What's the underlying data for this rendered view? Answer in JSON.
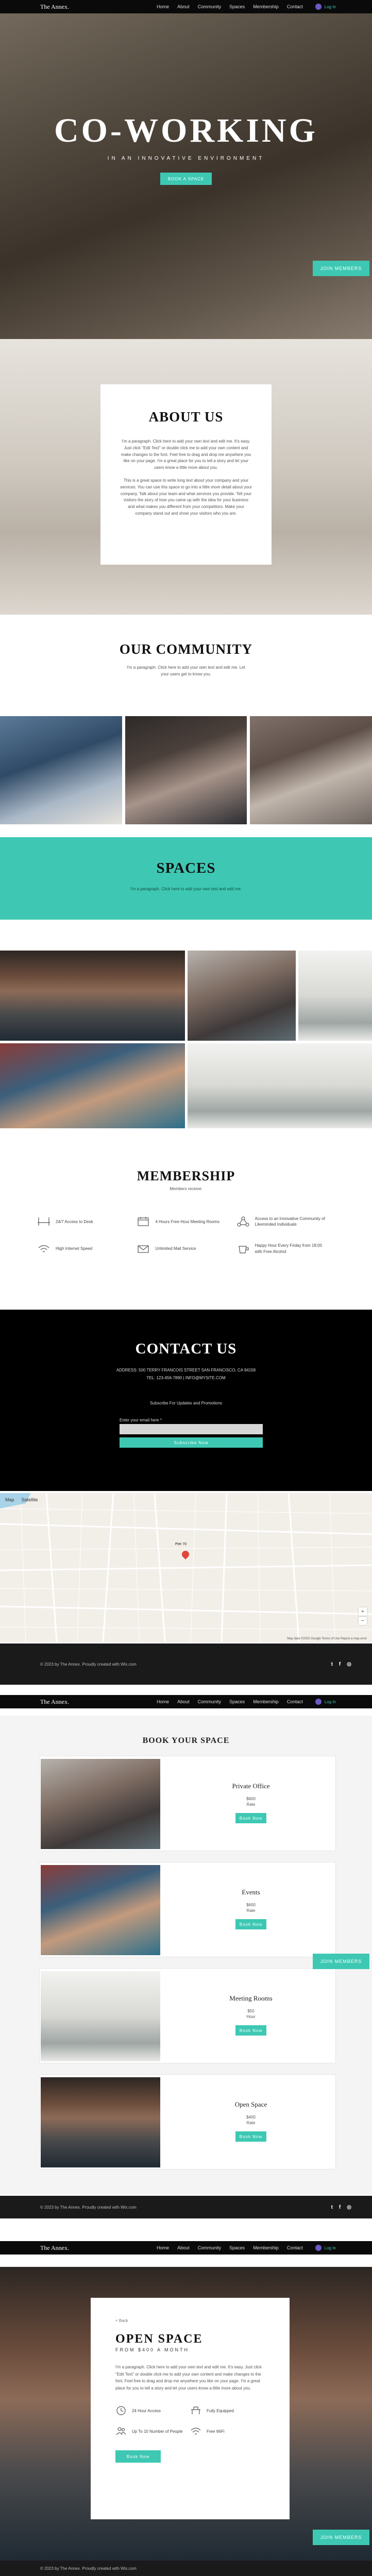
{
  "header": {
    "logo": "The Annex.",
    "nav": [
      "Home",
      "About",
      "Community",
      "Spaces",
      "Membership",
      "Contact"
    ],
    "login": "Log In"
  },
  "hero": {
    "title": "CO-WORKING",
    "subtitle": "IN AN INNOVATIVE ENVIRONMENT",
    "button": "BOOK A SPACE",
    "join_button": "JOIN MEMBERS"
  },
  "about": {
    "title": "ABOUT US",
    "paragraph_1": "I'm a paragraph. Click here to add your own text and edit me. It's easy. Just click \"Edit Text\" or double click me to add your own content and make changes to the font. Feel free to drag and drop me anywhere you like on your page. I'm a great place for you to tell a story and let your users know a little more about you.",
    "paragraph_2": "This is a great space to write long text about your company and your services. You can use this space to go into a little more detail about your company. Talk about your team and what services you provide. Tell your visitors the story of how you came up with the idea for your business and what makes you different from your competitors. Make your company stand out and show your visitors who you are."
  },
  "community": {
    "title": "OUR COMMUNITY",
    "text": "I'm a paragraph. Click here to add your own text and edit me. Let your users get to know you."
  },
  "spaces": {
    "title": "SPACES",
    "text": "I'm a paragraph. Click here to add your own text and edit me."
  },
  "membership": {
    "title": "MEMBERSHIP",
    "subtitle": "Members receive:",
    "perks": [
      {
        "icon": "chair-icon",
        "text": "24/7 Access to Desk"
      },
      {
        "icon": "calendar-icon",
        "text": "4 Hours Free Hour Meeting Rooms"
      },
      {
        "icon": "network-icon",
        "text": "Access to an Innovative Community of Likeminded Individuals"
      },
      {
        "icon": "wifi-icon",
        "text": "High Internet Speed"
      },
      {
        "icon": "mail-icon",
        "text": "Unlimited Mail Service"
      },
      {
        "icon": "coffee-icon",
        "text": "Happy Hour Every Friday from 18:00 with Free Alcohol"
      }
    ]
  },
  "contact": {
    "title": "CONTACT US",
    "address": "ADDRESS: 500 TERRY FRANCOIS STREET SAN FRANCISCO, CA 94158",
    "phone_email": "TEL: 123-456-7890  |  INFO@MYSITE.COM",
    "subscribe_text": "Subscribe For Updates and Promotions",
    "email_label": "Enter your email here *",
    "subscribe_button": "Subscribe Now"
  },
  "map": {
    "tab_map": "Map",
    "tab_satellite": "Satellite",
    "pin_label": "Pier 70",
    "zoom_in": "+",
    "zoom_out": "−",
    "attribution": "Map data ©2020 Google  Terms of Use  Report a map error"
  },
  "footer": {
    "text": "© 2023 by The Annex. Proudly created with Wix.com",
    "social": [
      "t",
      "f",
      "◎"
    ]
  },
  "book": {
    "title": "BOOK YOUR SPACE",
    "spaces": [
      {
        "name": "Private Office",
        "price": "$600",
        "unit": "Rate",
        "button": "Book Now"
      },
      {
        "name": "Events",
        "price": "$600",
        "unit": "Rate",
        "button": "Book Now"
      },
      {
        "name": "Meeting Rooms",
        "price": "$50",
        "unit": "Hour",
        "button": "Book Now"
      },
      {
        "name": "Open Space",
        "price": "$400",
        "unit": "Rate",
        "button": "Book Now"
      }
    ]
  },
  "detail": {
    "back_link": "< Back",
    "title": "OPEN SPACE",
    "subtitle": "FROM $400 A MONTH",
    "text": "I'm a paragraph. Click here to add your own text and edit me. It's easy. Just click \"Edit Text\" or double click me to add your own content and make changes to the font. Feel free to drag and drop me anywhere you like on your page. I'm a great place for you to tell a story and let your users know a little more about you.",
    "features": [
      {
        "icon": "clock-icon",
        "text": "24 Hour Access"
      },
      {
        "icon": "desk-icon",
        "text": "Fully Equipped"
      },
      {
        "icon": "people-icon",
        "text": "Up To 10 Number of People"
      },
      {
        "icon": "wifi-icon",
        "text": "Free WiFi"
      }
    ],
    "button": "Book Now"
  },
  "colors": {
    "accent": "#3ec8b3",
    "dark": "#0a0a0a",
    "footer": "#1a1a1a"
  }
}
